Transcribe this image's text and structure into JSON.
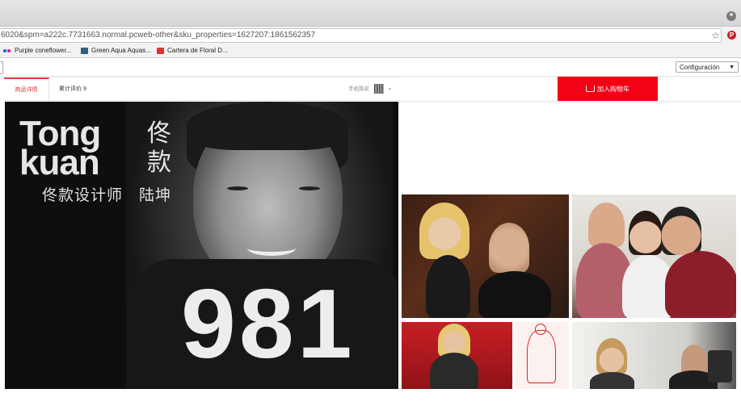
{
  "browser": {
    "url": "6020&spm=a222c.7731663.normal.pcweb-other&sku_properties=1627207:1861562357",
    "bookmarks": [
      {
        "label": "Purple coneflower...",
        "icon": "flickr-icon"
      },
      {
        "label": "Green Aqua Aquas...",
        "icon": "site-icon"
      },
      {
        "label": "Cartera de Floral D...",
        "icon": "image-icon"
      }
    ],
    "config_label": "Configuración"
  },
  "product_page": {
    "tabs": [
      {
        "label": "商品详情",
        "active": true
      },
      {
        "label": "累计评价 9",
        "active": false
      }
    ],
    "mobile_buy_label": "手机购买",
    "add_to_cart_label": "加入购物车",
    "accent_color": "#f10215"
  },
  "hero_banner": {
    "brand_line1": "Tong",
    "brand_line2": "kuan",
    "brand_cn": "佟款",
    "designer_text": "佟款设计师　陆坤",
    "jersey_number": "981"
  }
}
